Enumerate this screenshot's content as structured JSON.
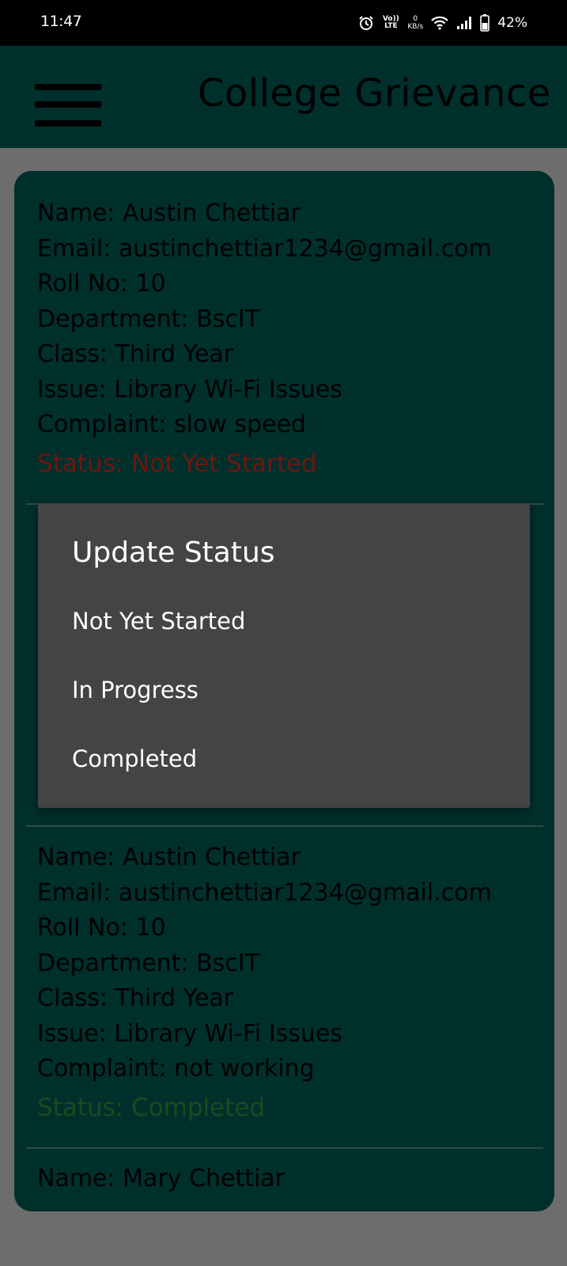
{
  "status_bar": {
    "time": "11:47",
    "volte_label": "Vo)) LTE",
    "network_speed": "0",
    "network_unit": "KB/s",
    "battery": "42%",
    "icons": [
      "alarm-icon",
      "volte-icon",
      "wifi-icon",
      "signal-icon",
      "battery-icon"
    ]
  },
  "app_bar": {
    "title": "College Grievance",
    "menu_icon": "hamburger-menu-icon"
  },
  "grievances": [
    {
      "name": "Name: Austin Chettiar",
      "email": "Email: austinchettiar1234@gmail.com",
      "roll": "Roll No: 10",
      "department": "Department: BscIT",
      "class": "Class: Third Year",
      "issue": "Issue: Library Wi-Fi Issues",
      "complaint": "Complaint: slow speed",
      "status": "Status: Not Yet Started"
    },
    {
      "name": "Name: Austin Chettiar",
      "email": "Email: austinchettiar1234@gmail.com",
      "roll": "Roll No: 10",
      "department": "Department: BscIT",
      "class": "Class: Third Year",
      "issue": "Issue: Library Wi-Fi Issues",
      "complaint": "Complaint: not working",
      "status": "Status: Completed"
    },
    {
      "name": "Name: Mary Chettiar"
    }
  ],
  "dialog": {
    "title": "Update Status",
    "options": [
      "Not Yet Started",
      "In Progress",
      "Completed"
    ]
  },
  "colors": {
    "app_bar": "#00302b",
    "card": "#00302b",
    "scrim": "#6d6d6d",
    "dialog": "#444444",
    "status_not_started": "#6e1612",
    "status_completed": "#1b4a1e"
  }
}
